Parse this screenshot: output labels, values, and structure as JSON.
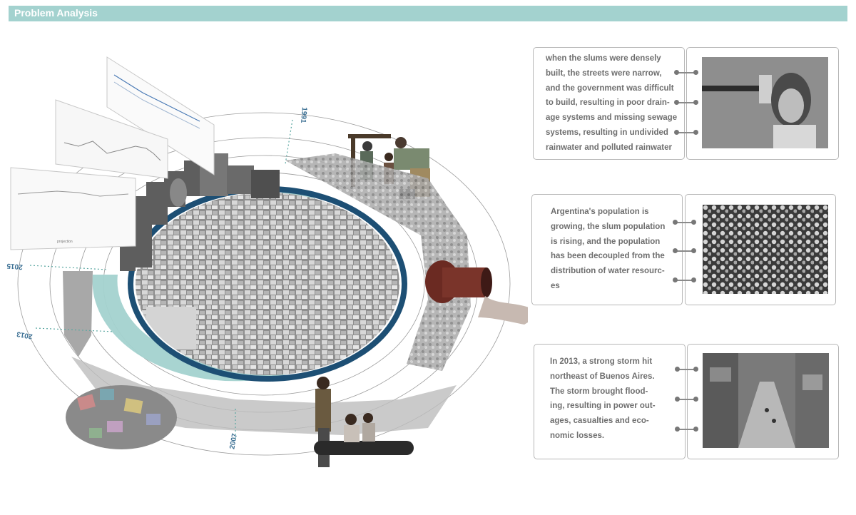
{
  "header": {
    "title": "Problem Analysis",
    "bar_color": "#a3d2cf"
  },
  "colors": {
    "accent": "#a3d2cf",
    "ring_dark": "#1d4f74",
    "rust": "#6b2a22"
  },
  "timeline": {
    "years": [
      "1991",
      "2015",
      "2013",
      "2007"
    ]
  },
  "chart_small": {
    "legend": "projection"
  },
  "panels": [
    {
      "text": "when the slums were densely\nbuilt, the streets were narrow,\nand the government was difficult\nto build, resulting in poor drain-\nage systems and missing sewage\nsystems, resulting in undivided\nrainwater and polluted rainwater",
      "photo_icon": "child-at-water-pipe-photo"
    },
    {
      "text": "Argentina's population is\ngrowing, the slum population\nis rising, and the population\nhas been decoupled from the\ndistribution of water resourc-\nes",
      "photo_icon": "crowd-aerial-photo"
    },
    {
      "text": "In 2013, a strong storm hit\nnortheast of Buenos Aires.\nThe storm brought flood-\ning, resulting in power out-\nages, casualties and eco-\nnomic losses.",
      "photo_icon": "flooded-street-photo"
    }
  ]
}
